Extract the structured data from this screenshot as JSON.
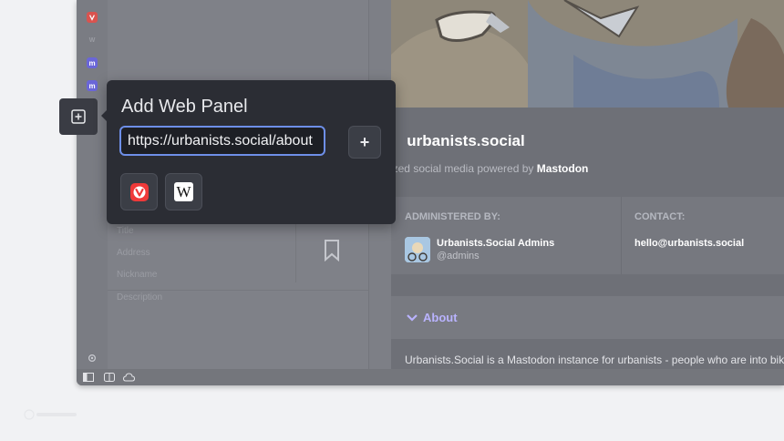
{
  "popup": {
    "title": "Add Web Panel",
    "url_value": "https://urbanists.social/about",
    "add_label": "+",
    "quick_panels": [
      {
        "name": "Vivaldi"
      },
      {
        "name": "Wikipedia",
        "glyph": "W"
      }
    ]
  },
  "sidebar_form": {
    "title_placeholder": "Title",
    "address_placeholder": "Address",
    "nickname_placeholder": "Nickname",
    "description_placeholder": "Description"
  },
  "page": {
    "site_title": "urbanists.social",
    "subtitle_prefix": "Decentralized social media powered by ",
    "subtitle_brand": "Mastodon",
    "administered_label": "ADMINISTERED BY:",
    "admin_name": "Urbanists.Social Admins",
    "admin_handle": "@admins",
    "contact_label": "CONTACT:",
    "contact_email": "hello@urbanists.social",
    "about_label": "About",
    "about_text": "Urbanists.Social is a Mastodon instance for urbanists - people who are into bikes, t"
  },
  "colors": {
    "accent": "#6e8fe8",
    "vivaldi_red": "#ef3939",
    "mastodon_purple": "#6364ff",
    "about_link": "#b9b3ff"
  }
}
